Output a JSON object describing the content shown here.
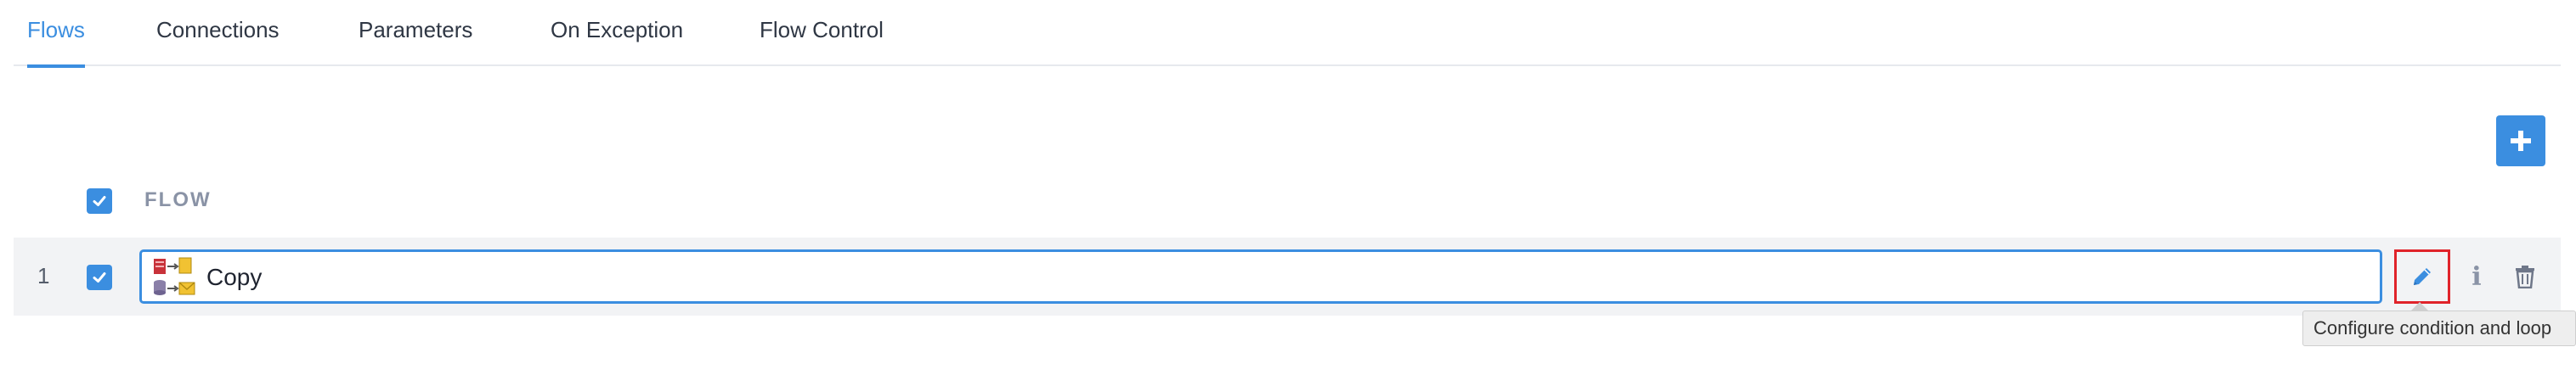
{
  "tabs": [
    {
      "label": "Flows",
      "active": true
    },
    {
      "label": "Connections",
      "active": false
    },
    {
      "label": "Parameters",
      "active": false
    },
    {
      "label": "On Exception",
      "active": false
    },
    {
      "label": "Flow Control",
      "active": false
    }
  ],
  "table": {
    "header": {
      "select_all_checked": true,
      "column_label": "FLOW"
    },
    "rows": [
      {
        "index": "1",
        "checked": true,
        "icon": "copy-flow-icon",
        "name": "Copy"
      }
    ]
  },
  "actions": {
    "add_icon": "plus-icon",
    "edit_icon": "pencil-icon",
    "info_icon": "info-icon",
    "delete_icon": "trash-icon"
  },
  "tooltip": {
    "text": "Configure condition and loop"
  },
  "colors": {
    "accent": "#3b8ee0",
    "highlight": "#e0232a",
    "row_bg": "#f2f3f5"
  }
}
